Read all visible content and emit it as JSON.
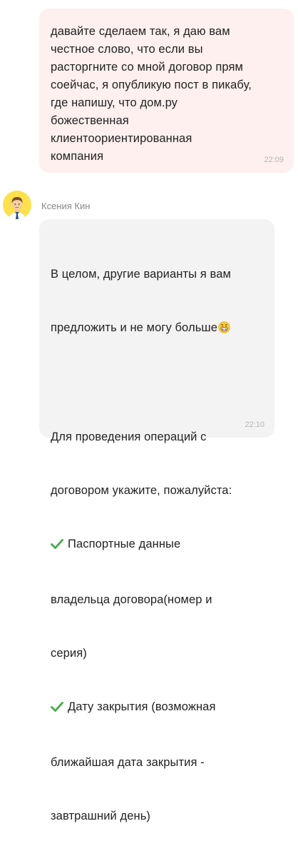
{
  "chat": {
    "messages": [
      {
        "direction": "outgoing",
        "text": "давайте сделаем так, я даю вам\nчестное слово, что если вы\nрасторгните со мной договор прям\nсоейчас, я опубликую пост в пикабу,\nгде напишу, что дом.ру\nбожественная\nклиентоориентированная\nкомпания",
        "time": "22:09"
      },
      {
        "direction": "incoming",
        "sender": "Ксения Кин",
        "lines": [
          "В целом, другие варианты я вам",
          "предложить и не могу больше",
          "",
          "Для проведения операций с",
          "договором укажите, пожалуйста:",
          "Паспортные данные",
          "владельца договора(номер и",
          "серия)",
          "Дату закрытия (возможная",
          "ближайшая дата закрытия -",
          "завтрашний день)"
        ],
        "time": "22:10",
        "icons": {
          "emoji": "grinning-face-icon",
          "bullet": "check-mark-icon"
        }
      }
    ]
  },
  "colors": {
    "outgoing_bubble": "#fdf0ee",
    "incoming_bubble": "#f3f3f3",
    "avatar_bg": "#fde14a",
    "check_green": "#4caf50",
    "time_text": "#b5b5b5"
  }
}
